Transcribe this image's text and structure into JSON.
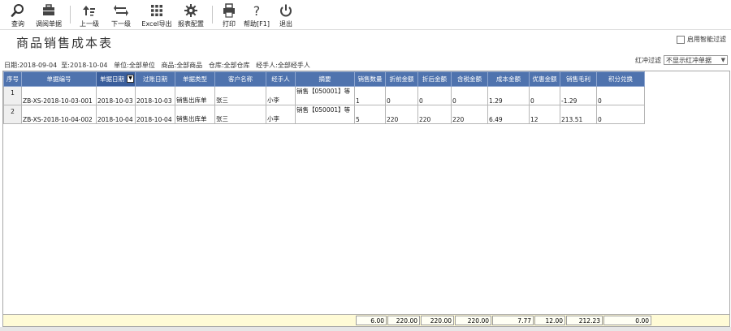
{
  "toolbar": {
    "buttons": [
      {
        "label": "查询",
        "icon": "search-icon"
      },
      {
        "label": "调阅单据",
        "icon": "briefcase-icon"
      },
      {
        "label": "上一级",
        "icon": "sort-up-icon"
      },
      {
        "label": "下一级",
        "icon": "swap-arrows-icon"
      },
      {
        "label": "Excel导出",
        "icon": "grid-dots-icon"
      },
      {
        "label": "报表配置",
        "icon": "gear-icon"
      },
      {
        "label": "打印",
        "icon": "printer-icon"
      },
      {
        "label": "帮助[F1]",
        "icon": "help-icon"
      },
      {
        "label": "退出",
        "icon": "power-icon"
      }
    ]
  },
  "page": {
    "title": "商品销售成本表",
    "smart_filter_label": "启用智能过滤",
    "red_filter_label": "红冲过滤",
    "red_filter_value": "不显示红冲单据"
  },
  "filters": {
    "date_label": "日期:",
    "date_from": "2018-09-04",
    "date_to_label": "至:",
    "date_to": "2018-10-04",
    "unit_label": "单位:",
    "unit": "全部单位",
    "goods_label": "商品:",
    "goods": "全部商品",
    "warehouse_label": "仓库:",
    "warehouse": "全部仓库",
    "handler_label": "经手人:",
    "handler": "全部经手人"
  },
  "grid": {
    "columns": [
      "序号",
      "单据编号",
      "单据日期",
      "过账日期",
      "单据类型",
      "客户名称",
      "经手人",
      "摘要",
      "销售数量",
      "折前金额",
      "折后金额",
      "含税金额",
      "成本金额",
      "优惠金额",
      "销售毛利",
      "积分兑换"
    ],
    "rows": [
      {
        "no": "1",
        "doc_no": "ZB-XS-2018-10-03-001",
        "doc_date": "2018-10-03",
        "post_date": "2018-10-03",
        "doc_type": "销售出库单",
        "customer": "张三",
        "handler": "小李",
        "summary": "销售【050001】等",
        "qty": "1",
        "pre_amount": "0",
        "post_amount": "0",
        "tax_amount": "0",
        "cost": "1.29",
        "discount": "0",
        "profit": "-1.29",
        "points": "0"
      },
      {
        "no": "2",
        "doc_no": "ZB-XS-2018-10-04-002",
        "doc_date": "2018-10-04",
        "post_date": "2018-10-04",
        "doc_type": "销售出库单",
        "customer": "张三",
        "handler": "小李",
        "summary": "销售【050001】等",
        "qty": "5",
        "pre_amount": "220",
        "post_amount": "220",
        "tax_amount": "220",
        "cost": "6.49",
        "discount": "12",
        "profit": "213.51",
        "points": "0"
      }
    ],
    "totals": {
      "qty": "6.00",
      "pre_amount": "220.00",
      "post_amount": "220.00",
      "tax_amount": "220.00",
      "cost": "7.77",
      "discount": "12.00",
      "profit": "212.23",
      "points": "0.00"
    }
  },
  "colors": {
    "header_bg": "#4f73ae",
    "footer_bg": "#fffbd6"
  }
}
